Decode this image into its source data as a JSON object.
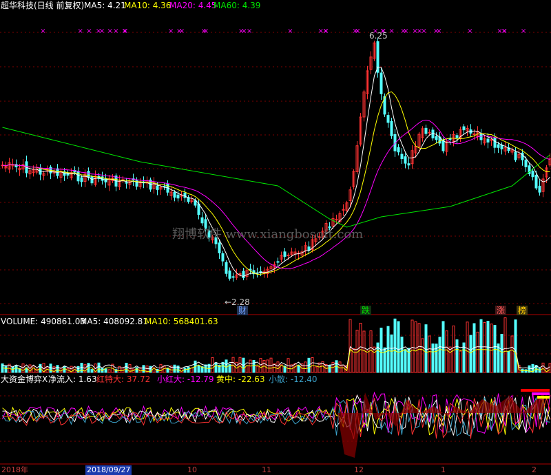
{
  "header": {
    "stock_title": "超华科技(日线 前复权)",
    "ma5_label": "MA5: 4.21",
    "ma10_label": "MA10: 4.36",
    "ma20_label": "MA20: 4.45",
    "ma60_label": "MA60: 4.39"
  },
  "price_panel": {
    "high_label": "6.25",
    "low_label": "←2.28",
    "watermark": "翔博软件 www.xiangbosoft.com",
    "event_tags": [
      "财",
      "跌",
      "涨",
      "榜"
    ]
  },
  "volume_panel": {
    "volume_label": "VOLUME: 490861.03",
    "ma5_label": "MA5: 408092.81",
    "ma10_label": "MA10: 568401.63"
  },
  "indicator_panel": {
    "name": "大资金博弈X",
    "net_inflow": "净流入: 1.63",
    "red_big": "红特大: 37.72",
    "small_red": "小红大: -12.79",
    "yellow_mid": "黄中: -22.63",
    "small_scatter": "小散: -12.40"
  },
  "axis_dates": [
    "2018年",
    "2018/09/27",
    "10",
    "11",
    "12",
    "1",
    "2"
  ],
  "colors": {
    "background": "#000000",
    "up": "#ff3232",
    "down": "#54ffff",
    "ma5": "#ffffff",
    "ma10": "#ffff00",
    "ma20": "#ff00ff",
    "ma60": "#00e600",
    "grid": "#7f0000"
  }
}
